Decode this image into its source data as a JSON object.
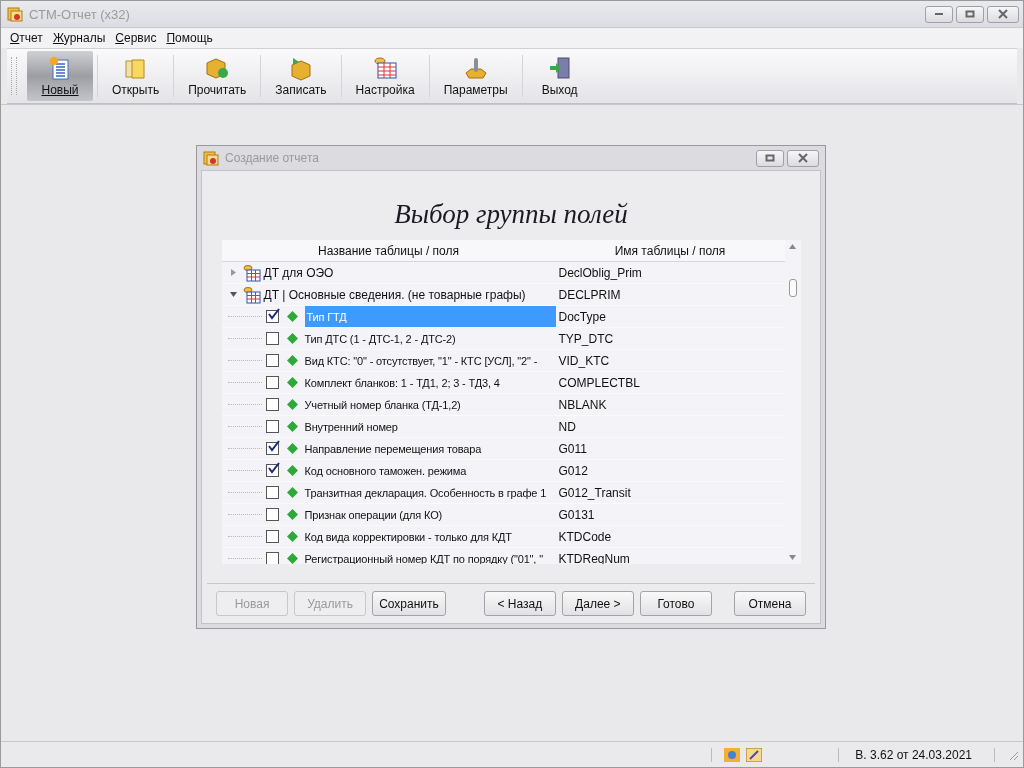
{
  "window": {
    "title": "СТМ-Отчет (x32)"
  },
  "menu": [
    {
      "label": "Отчет"
    },
    {
      "label": "Журналы"
    },
    {
      "label": "Сервис"
    },
    {
      "label": "Помощь"
    }
  ],
  "toolbar": [
    {
      "label": "Новый",
      "kind": "new",
      "selected": true
    },
    {
      "label": "Открыть",
      "kind": "open",
      "selected": false
    },
    {
      "label": "Прочитать",
      "kind": "read",
      "selected": false
    },
    {
      "label": "Записать",
      "kind": "write",
      "selected": false
    },
    {
      "label": "Настройка",
      "kind": "setup",
      "selected": false
    },
    {
      "label": "Параметры",
      "kind": "params",
      "selected": false
    },
    {
      "label": "Выход",
      "kind": "exit",
      "selected": false
    }
  ],
  "dialog": {
    "title": "Создание отчета",
    "heading": "Выбор группы полей",
    "columns": [
      "Название таблицы / поля",
      "Имя таблицы / поля"
    ],
    "tree": [
      {
        "name": "ДТ для ОЭО",
        "table": "DeclOblig_Prim",
        "expanded": false
      },
      {
        "name": "ДТ | Основные сведения. (не товарные графы)",
        "table": "DECLPRIM",
        "expanded": true,
        "children": [
          {
            "name": "Тип ГТД",
            "table": "DocType",
            "checked": true,
            "selected": true
          },
          {
            "name": "Тип ДТС (1 - ДТС-1, 2 - ДТС-2)",
            "table": "TYP_DTC",
            "checked": false,
            "selected": false
          },
          {
            "name": "Вид КТС: \"0\" - отсутствует, \"1\" - КТС [УСЛ], \"2\" -",
            "table": "VID_KTC",
            "checked": false,
            "selected": false
          },
          {
            "name": "Комплект бланков: 1 - ТД1, 2; 3 - ТД3, 4",
            "table": "COMPLECTBL",
            "checked": false,
            "selected": false
          },
          {
            "name": "Учетный номер бланка (ТД-1,2)",
            "table": "NBLANK",
            "checked": false,
            "selected": false
          },
          {
            "name": "Внутренний номер",
            "table": "ND",
            "checked": false,
            "selected": false
          },
          {
            "name": "Направление перемещения товара",
            "table": "G011",
            "checked": true,
            "selected": false
          },
          {
            "name": "Код основного таможен. режима",
            "table": "G012",
            "checked": true,
            "selected": false
          },
          {
            "name": "Транзитная декларация. Особенность в графе 1",
            "table": "G012_Transit",
            "checked": false,
            "selected": false
          },
          {
            "name": "Признак операции (для КО)",
            "table": "G0131",
            "checked": false,
            "selected": false
          },
          {
            "name": "Код вида корректировки - только для КДТ",
            "table": "KTDCode",
            "checked": false,
            "selected": false
          },
          {
            "name": "Регистрационный номер КДТ по порядку (\"01\", \"",
            "table": "KTDRegNum",
            "checked": false,
            "selected": false
          }
        ]
      }
    ],
    "buttons": [
      {
        "label": "Новая",
        "disabled": true
      },
      {
        "label": "Удалить",
        "disabled": true
      },
      {
        "label": "Сохранить",
        "disabled": false
      },
      {
        "label": "< Назад",
        "disabled": false
      },
      {
        "label": "Далее >",
        "disabled": false
      },
      {
        "label": "Готово",
        "disabled": false
      },
      {
        "label": "Отмена",
        "disabled": false
      }
    ]
  },
  "status_bar": {
    "version": "В. 3.62 от 24.03.2021"
  }
}
